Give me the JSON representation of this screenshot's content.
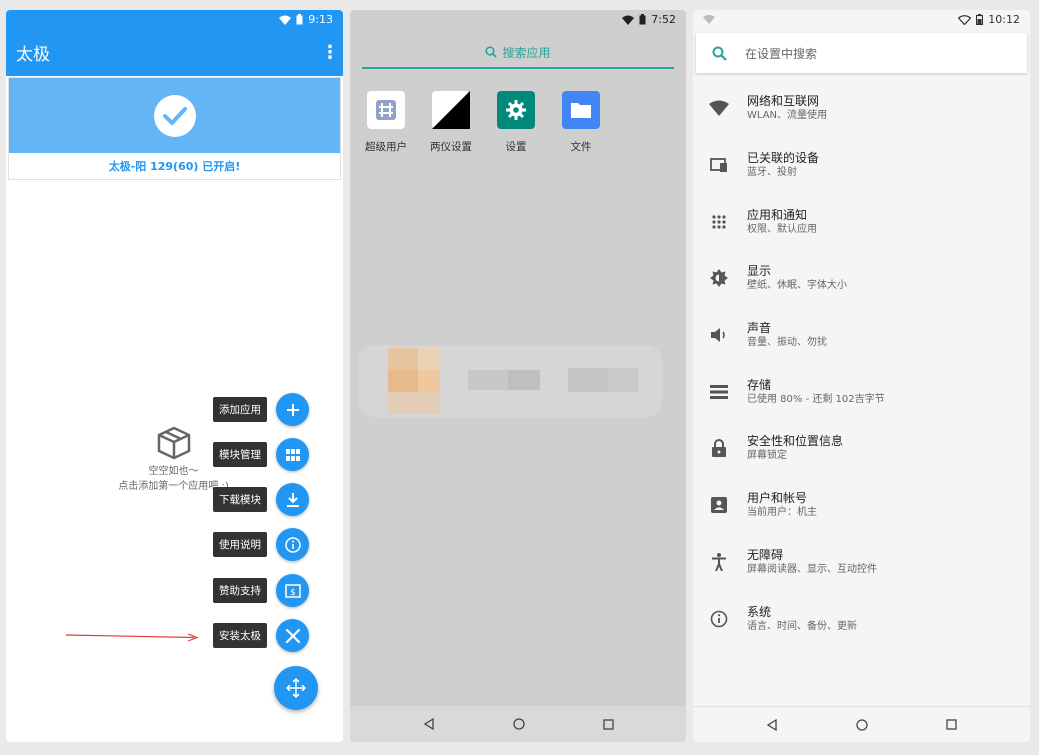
{
  "phone1": {
    "status_time": "9:13",
    "app_title": "太极",
    "status_message": "太极-阳 129(60) 已开启!",
    "empty_line1": "空空如也～",
    "empty_line2": "点击添加第一个应用吧 :)",
    "fab_actions": [
      {
        "label": "添加应用",
        "icon": "plus-icon"
      },
      {
        "label": "模块管理",
        "icon": "grid-icon"
      },
      {
        "label": "下载模块",
        "icon": "download-icon"
      },
      {
        "label": "使用说明",
        "icon": "info-icon"
      },
      {
        "label": "赞助支持",
        "icon": "money-icon"
      },
      {
        "label": "安装太极",
        "icon": "tools-icon"
      }
    ],
    "colors": {
      "primary": "#2196f3",
      "banner": "#64b5f6",
      "arrow": "#e53935"
    }
  },
  "phone2": {
    "status_time": "7:52",
    "search_label": "搜索应用",
    "apps": [
      {
        "label": "超级用户",
        "icon": "superuser-icon"
      },
      {
        "label": "两仪设置",
        "icon": "liangyi-icon"
      },
      {
        "label": "设置",
        "icon": "settings-gear-icon"
      },
      {
        "label": "文件",
        "icon": "folder-icon"
      }
    ],
    "colors": {
      "accent": "#26a69a"
    }
  },
  "phone3": {
    "status_time": "10:12",
    "search_placeholder": "在设置中搜索",
    "items": [
      {
        "title": "网络和互联网",
        "subtitle": "WLAN、流量使用",
        "icon": "wifi-icon"
      },
      {
        "title": "已关联的设备",
        "subtitle": "蓝牙、投射",
        "icon": "devices-icon"
      },
      {
        "title": "应用和通知",
        "subtitle": "权限、默认应用",
        "icon": "apps-icon"
      },
      {
        "title": "显示",
        "subtitle": "壁纸、休眠、字体大小",
        "icon": "brightness-icon"
      },
      {
        "title": "声音",
        "subtitle": "音量、振动、勿扰",
        "icon": "volume-icon"
      },
      {
        "title": "存储",
        "subtitle": "已使用 80% - 还剩 102吉字节",
        "icon": "storage-icon"
      },
      {
        "title": "安全性和位置信息",
        "subtitle": "屏幕锁定",
        "icon": "lock-icon"
      },
      {
        "title": "用户和帐号",
        "subtitle": "当前用户：机主",
        "icon": "account-icon"
      },
      {
        "title": "无障碍",
        "subtitle": "屏幕阅读器、显示、互动控件",
        "icon": "accessibility-icon"
      },
      {
        "title": "系统",
        "subtitle": "语言、时间、备份、更新",
        "icon": "info-icon"
      }
    ],
    "colors": {
      "accent": "#26a69a"
    }
  }
}
